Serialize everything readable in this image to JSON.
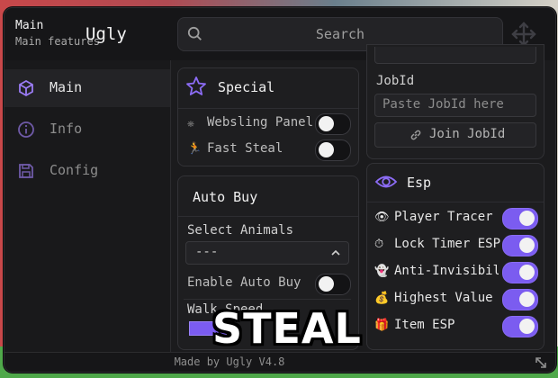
{
  "window": {
    "title": "Main",
    "subtitle": "Main features",
    "brand": "Ugly",
    "search_placeholder": "Search",
    "footer": "Made by Ugly V4.8"
  },
  "sidebar": {
    "items": [
      {
        "label": "Main",
        "icon": "cube-icon",
        "active": true
      },
      {
        "label": "Info",
        "icon": "info-icon",
        "active": false
      },
      {
        "label": "Config",
        "icon": "save-icon",
        "active": false
      }
    ]
  },
  "special": {
    "title": "Special",
    "items": [
      {
        "label": "Websling Panel",
        "icon": "sparkle-icon",
        "on": false
      },
      {
        "label": "Fast Steal",
        "icon": "runner-icon",
        "on": false
      }
    ]
  },
  "autobuy": {
    "title": "Auto Buy",
    "select_label": "Select Animals",
    "select_value": "---",
    "enable_label": "Enable Auto Buy",
    "enable_on": false,
    "walk_speed_label": "Walk Speed"
  },
  "jobid": {
    "label": "JobId",
    "placeholder": "Paste JobId here",
    "join_label": "Join JobId"
  },
  "esp": {
    "title": "Esp",
    "items": [
      {
        "label": "Player Tracer",
        "icon": "eye-icon",
        "on": true
      },
      {
        "label": "Lock Timer ESP",
        "icon": "stopwatch-icon",
        "on": true
      },
      {
        "label": "Anti-Invisibili",
        "icon": "ghost-icon",
        "on": true
      },
      {
        "label": "Highest Value",
        "icon": "money-bag-icon",
        "on": true
      },
      {
        "label": "Item ESP",
        "icon": "gift-icon",
        "on": true
      }
    ]
  },
  "overlay": {
    "text": "STEAL"
  },
  "colors": {
    "accent": "#7b5cf0",
    "panel": "#1b1b1d"
  }
}
